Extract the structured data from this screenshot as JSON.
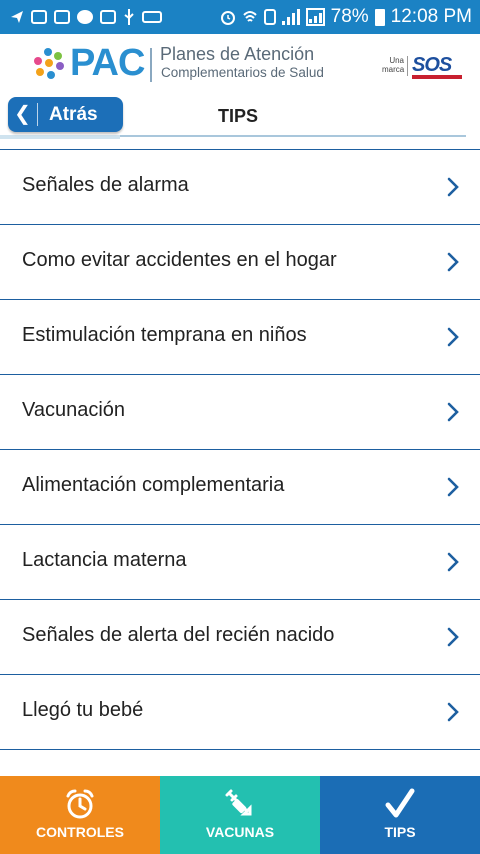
{
  "statusbar": {
    "battery": "78%",
    "time": "12:08 PM"
  },
  "header": {
    "logo_main": "PAC",
    "logo_line1": "Planes de Atención",
    "logo_line2": "Complementarios de Salud",
    "brand_prefix_1": "Una",
    "brand_prefix_2": "marca",
    "brand": "SOS"
  },
  "nav": {
    "back_label": "Atrás",
    "title": "TIPS"
  },
  "tips_list": [
    {
      "label": "Señales de alarma"
    },
    {
      "label": "Como evitar accidentes en el hogar"
    },
    {
      "label": "Estimulación temprana en niños"
    },
    {
      "label": "Vacunación"
    },
    {
      "label": "Alimentación complementaria"
    },
    {
      "label": "Lactancia materna"
    },
    {
      "label": "Señales de alerta del recién nacido"
    },
    {
      "label": "Llegó tu bebé"
    }
  ],
  "tabs": [
    {
      "label": "CONTROLES",
      "icon": "alarm-clock-icon",
      "color": "#f08a1c"
    },
    {
      "label": "VACUNAS",
      "icon": "syringe-icon",
      "color": "#23c0b0"
    },
    {
      "label": "TIPS",
      "icon": "checkmark-icon",
      "color": "#1b6db5"
    }
  ],
  "colors": {
    "statusbar": "#1b82c4",
    "accent": "#1c6fb8",
    "chevron": "#1d5fa0"
  }
}
